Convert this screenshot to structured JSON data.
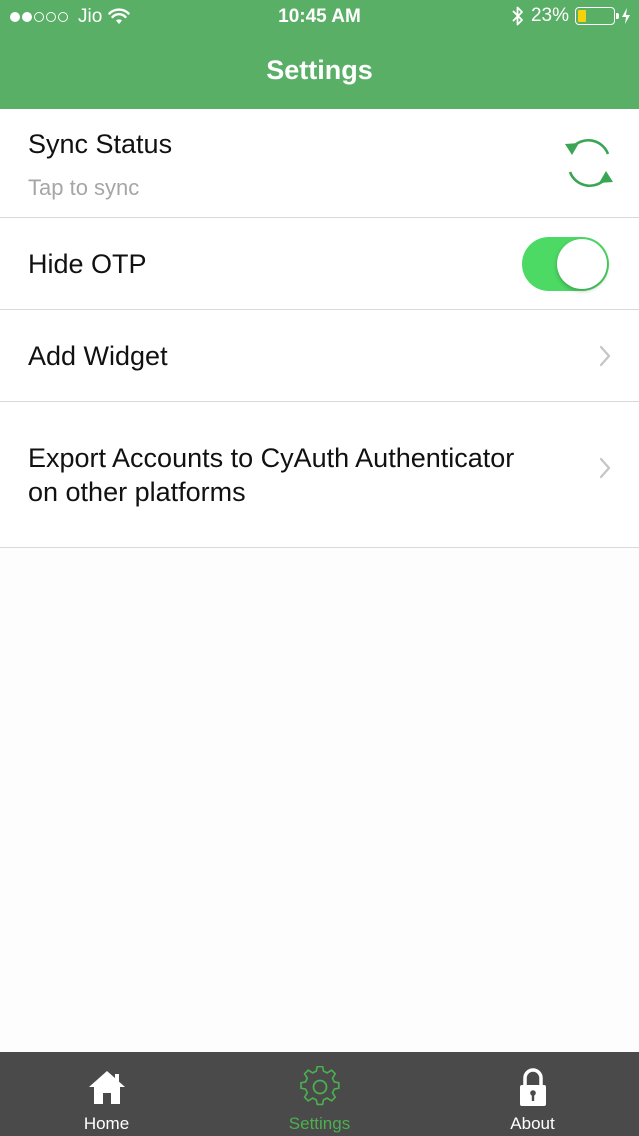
{
  "status_bar": {
    "carrier": "Jio",
    "time": "10:45 AM",
    "battery_percent": "23%",
    "battery_level": 0.23,
    "signal_bars_filled": 2,
    "signal_bars_total": 5
  },
  "header": {
    "title": "Settings",
    "color": "#5aaf66"
  },
  "settings": {
    "sync": {
      "title": "Sync Status",
      "subtitle": "Tap to sync",
      "icon": "sync-icon"
    },
    "hide_otp": {
      "title": "Hide OTP",
      "enabled": true,
      "toggle_color": "#4cd964"
    },
    "add_widget": {
      "title": "Add Widget",
      "icon": "chevron-right-icon"
    },
    "export": {
      "title_line1": "Export Accounts to CyAuth Authenticator",
      "title_line2": "on other platforms",
      "icon": "chevron-right-icon"
    }
  },
  "tabbar": {
    "tabs": [
      {
        "label": "Home",
        "icon": "home-icon",
        "active": false
      },
      {
        "label": "Settings",
        "icon": "gear-icon",
        "active": true
      },
      {
        "label": "About",
        "icon": "lock-icon",
        "active": false
      }
    ],
    "active_color": "#4caf50",
    "background": "#4a4a4a"
  }
}
